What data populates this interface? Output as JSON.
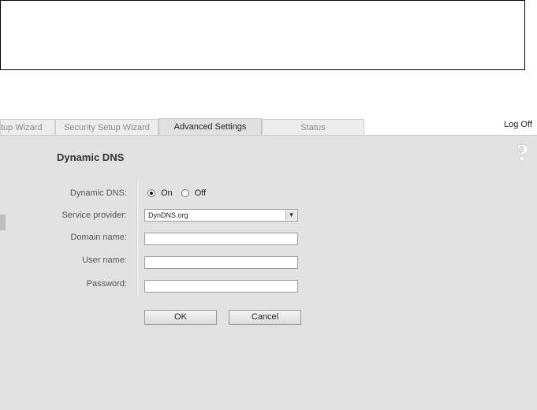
{
  "tabs": [
    {
      "label": "tup Wizard"
    },
    {
      "label": "Security Setup Wizard"
    },
    {
      "label": "Advanced Settings"
    },
    {
      "label": "Status"
    }
  ],
  "header": {
    "logoff_label": "Log Off"
  },
  "page": {
    "title": "Dynamic DNS",
    "help_glyph": "?"
  },
  "form": {
    "dynamic_dns_label": "Dynamic DNS:",
    "radio_on_label": "On",
    "radio_off_label": "Off",
    "dynamic_dns_value": "On",
    "service_provider_label": "Service provider:",
    "service_provider_value": "DynDNS.org",
    "domain_name_label": "Domain name:",
    "domain_name_value": "",
    "user_name_label": "User name:",
    "user_name_value": "",
    "password_label": "Password:",
    "password_value": ""
  },
  "buttons": {
    "ok_label": "OK",
    "cancel_label": "Cancel"
  }
}
